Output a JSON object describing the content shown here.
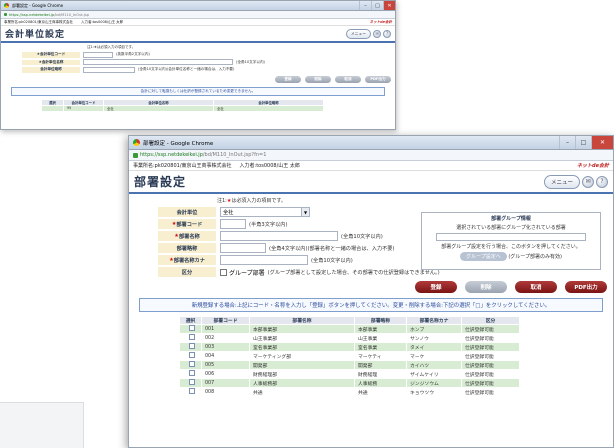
{
  "back_window": {
    "title": "部署設定 - Google Chrome",
    "url_host": "https://ssp.netdekeikei.jp",
    "url_rest": "/bd/M110_InOut.jsp",
    "info_office": "事業所名:pk020801/東京山王商事株式会社",
    "info_user": "入力者:tos0008/山王 太郎",
    "brand": "ネットde会計",
    "page_title": "会計単位設定",
    "menu_label": "メニュー",
    "note": "注1:★は必須入力の項目です。",
    "fields": [
      {
        "label": "★会計単位コード",
        "hint": "(英数半角2文字以内)"
      },
      {
        "label": "★会計単位名称",
        "hint": "(全角10文字以内)"
      },
      {
        "label": "会計単位略称",
        "hint": "(全角10文字以内)(会計単位名称と一緒の場合は、入力不要)"
      }
    ],
    "buttons": [
      "登録",
      "削除",
      "取消",
      "PDF出力"
    ],
    "message": "会計に対して転換もしくは仕訳が登録されているため変更できません。",
    "table_headers": [
      "選択",
      "会計単位コード",
      "会計単位名称",
      "会計単位略称"
    ],
    "rows": [
      [
        "",
        "95",
        "全社",
        "全社"
      ]
    ]
  },
  "front_window": {
    "title": "部署設定 - Google Chrome",
    "url_host": "https://ssp.netdekeikei.jp",
    "url_rest": "/bd/M110_InOut.jsp?fn=1",
    "info_office": "事業所名:pk020801/東京山王商事株式会社",
    "info_user": "入力者:tos0008/山王 太郎",
    "brand": "ネットde会計",
    "page_title": "部署設定",
    "menu_label": "メニュー",
    "note_mark": "★",
    "note_pre": "注1:",
    "note_post": "は必須入力の項目です。",
    "fields": {
      "unit": {
        "label": "会計単位",
        "value": "全社"
      },
      "code": {
        "label": "部署コード",
        "hint": "(半角3文字以内)"
      },
      "name": {
        "label": "部署名称",
        "hint": "(全角10文字以内)"
      },
      "abbr": {
        "label": "部署略称",
        "hint": "(全角4文字以内)(部署名称と一緒の場合は、入力不要)"
      },
      "kana": {
        "label": "部署名称カナ",
        "hint": "(全角10文字以内)"
      },
      "kubun": {
        "label": "区分",
        "checkbox_label": "グループ部署",
        "hint": "(グループ部署として設定した場合、その部署での仕訳登録はできません。)"
      }
    },
    "group_panel": {
      "title": "部署グループ情報",
      "desc": "選択されている部署にグループ化されている部署",
      "note": "部署グループ設定を行う場合、このボタンを押してください。",
      "button": "グループ設定へ",
      "button_note": "(グループ部署のみ有効)"
    },
    "buttons": {
      "register": "登録",
      "delete": "削除",
      "cancel": "取消",
      "pdf": "PDF出力"
    },
    "message": "新規登録する場合:上記にコード・名称を入力し「登録」ボタンを押してください。変更・削除する場合:下記の選択「□」をクリックしてください。",
    "table_headers": [
      "選択",
      "部署コード",
      "部署名称",
      "部署略称",
      "部署名称カナ",
      "区分"
    ],
    "rows": [
      [
        "001",
        "本部事業部",
        "本部事業",
        "ホンブ",
        "仕訳登録可能"
      ],
      [
        "002",
        "山王事業部",
        "山王事業",
        "サンノウ",
        "仕訳登録可能"
      ],
      [
        "003",
        "室名事業部",
        "室名事業",
        "タメイ",
        "仕訳登録可能"
      ],
      [
        "004",
        "マーケティング部",
        "マーケティ",
        "マーケ",
        "仕訳登録可能"
      ],
      [
        "005",
        "開発部",
        "開発部",
        "カイハツ",
        "仕訳登録可能"
      ],
      [
        "006",
        "財務経理部",
        "財務経理",
        "ザイムケイリ",
        "仕訳登録可能"
      ],
      [
        "007",
        "人事総務部",
        "人事総務",
        "ジンジソウム",
        "仕訳登録可能"
      ],
      [
        "008",
        "共通",
        "共通",
        "キョウツウ",
        "仕訳登録可能"
      ]
    ]
  }
}
